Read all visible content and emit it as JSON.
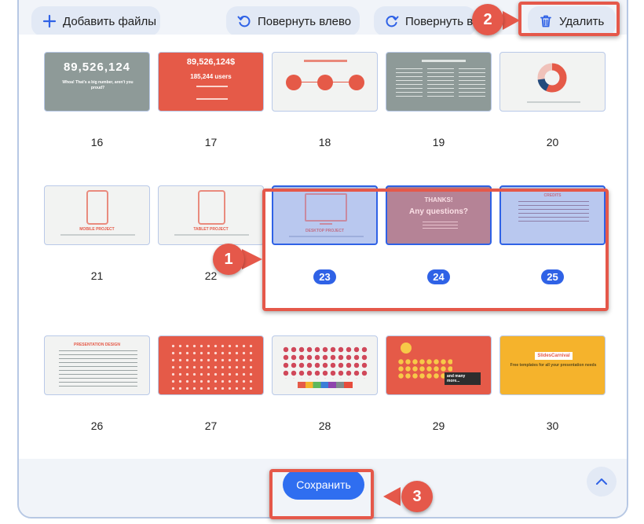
{
  "toolbar": {
    "add_files": "Добавить файлы",
    "rotate_left": "Повернуть влево",
    "rotate_right": "Повернуть вправо",
    "delete": "Удалить"
  },
  "pages": [
    {
      "number": "16",
      "selected": false,
      "bg": "#8e9a98",
      "title": "89,526,124",
      "subtitle": "Whoa! That's a big number, aren't you proud?"
    },
    {
      "number": "17",
      "selected": false,
      "bg": "#e55a48",
      "title": "89,526,124$",
      "subtitle": "185,244 users"
    },
    {
      "number": "18",
      "selected": false,
      "bg": "#f2f3f2"
    },
    {
      "number": "19",
      "selected": false,
      "bg": "#8e9a98"
    },
    {
      "number": "20",
      "selected": false,
      "bg": "#f2f3f2"
    },
    {
      "number": "21",
      "selected": false,
      "bg": "#f2f3f2",
      "title": "MOBILE PROJECT"
    },
    {
      "number": "22",
      "selected": false,
      "bg": "#f2f3f2",
      "title": "TABLET PROJECT"
    },
    {
      "number": "23",
      "selected": true,
      "bg": "#b9c8ef",
      "title": "DESKTOP PROJECT"
    },
    {
      "number": "24",
      "selected": true,
      "bg": "#b58396",
      "title": "THANKS!",
      "subtitle": "Any questions?"
    },
    {
      "number": "25",
      "selected": true,
      "bg": "#b9c8ef",
      "title": "CREDITS"
    },
    {
      "number": "26",
      "selected": false,
      "bg": "#f2f3f2",
      "title": "PRESENTATION DESIGN"
    },
    {
      "number": "27",
      "selected": false,
      "bg": "#e55a48"
    },
    {
      "number": "28",
      "selected": false,
      "bg": "#f2f3f2"
    },
    {
      "number": "29",
      "selected": false,
      "bg": "#e55a48",
      "subtitle": "and many more..."
    },
    {
      "number": "30",
      "selected": false,
      "bg": "#f5b32c",
      "title": "SlidesCarnival",
      "subtitle": "Free templates for all your presentation needs"
    }
  ],
  "bottom": {
    "save": "Сохранить"
  },
  "callouts": [
    "1",
    "2",
    "3"
  ],
  "colors": {
    "accent": "#2f6ef0",
    "callout": "#e5584a",
    "selection": "#2f62e6"
  },
  "icons": {
    "add": "plus-icon",
    "rotate_left": "rotate-left-icon",
    "rotate_right": "rotate-right-icon",
    "delete": "trash-icon",
    "scroll_up": "chevron-up-icon"
  }
}
